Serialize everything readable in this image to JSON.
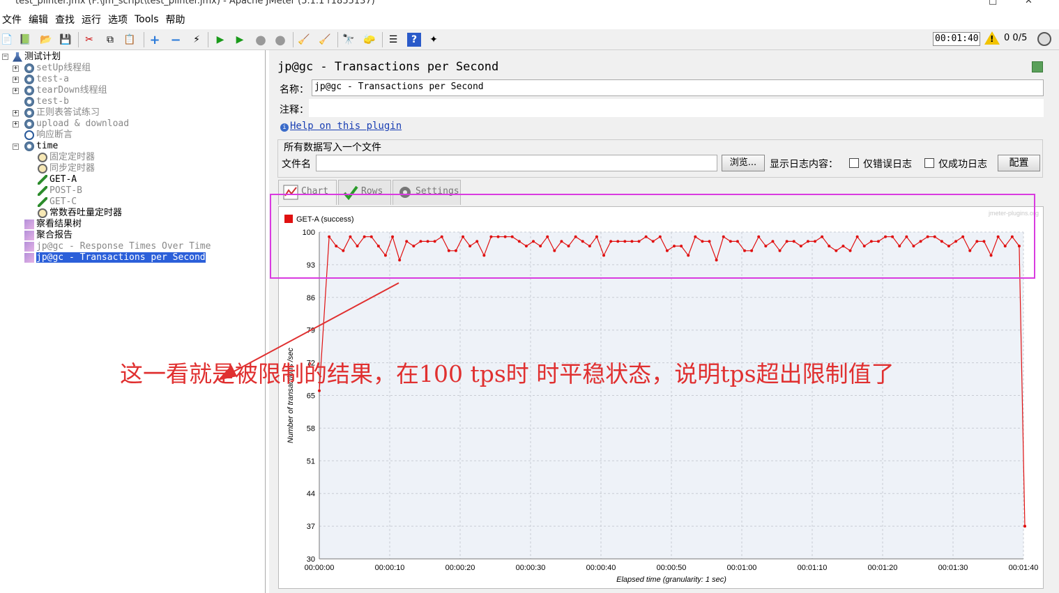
{
  "window": {
    "title": "test_plinter.jmx (F:\\jm_script\\test_plinter.jmx) - Apache JMeter (5.1.1 r1855137)"
  },
  "menu": [
    "文件",
    "编辑",
    "查找",
    "运行",
    "选项",
    "Tools",
    "帮助"
  ],
  "status": {
    "timer": "00:01:40",
    "warnings": "0",
    "threads": "0/5"
  },
  "tree": {
    "root": "测试计划",
    "items": [
      "setUp线程组",
      "test-a",
      "tearDown线程组",
      "test-b",
      "正则表答试练习",
      "upload & download",
      "响应断言",
      "time",
      "固定定时器",
      "同步定时器",
      "GET-A",
      "POST-B",
      "GET-C",
      "常数吞吐量定时器",
      "察看结果树",
      "聚合报告",
      "jp@gc - Response Times Over Time",
      "jp@gc - Transactions per Second"
    ]
  },
  "panel": {
    "title": "jp@gc - Transactions per Second",
    "name_label": "名称：",
    "name_value": "jp@gc - Transactions per Second",
    "comment_label": "注释：",
    "help_link": "Help on this plugin",
    "file_group": "所有数据写入一个文件",
    "file_label": "文件名",
    "browse": "浏览...",
    "log_label": "显示日志内容：",
    "err_only": "仅错误日志",
    "ok_only": "仅成功日志",
    "config": "配置"
  },
  "tabs": [
    "Chart",
    "Rows",
    "Settings"
  ],
  "annotation": "这一看就是被限制的结果，在100 tps时 时平稳状态，说明tps超出限制值了",
  "chart_data": {
    "type": "line",
    "watermark": "jmeter-plugins.org",
    "xlabel": "Elapsed time (granularity: 1 sec)",
    "ylabel": "Number of transactions /sec",
    "ylim": [
      30,
      100
    ],
    "yticks": [
      "100",
      "93",
      "86",
      "79",
      "72",
      "65",
      "58",
      "51",
      "44",
      "37",
      "30"
    ],
    "xticks": [
      "00:00:00",
      "00:00:10",
      "00:00:20",
      "00:00:30",
      "00:00:40",
      "00:00:50",
      "00:01:00",
      "00:01:10",
      "00:01:20",
      "00:01:30",
      "00:01:40"
    ],
    "series": [
      {
        "name": "GET-A (success)",
        "color": "#e01010",
        "x": [
          0,
          1,
          2,
          3,
          4,
          5,
          6,
          7,
          8,
          9,
          10,
          11,
          12,
          13,
          14,
          15,
          16,
          17,
          18,
          19,
          20,
          21,
          22,
          23,
          24,
          25,
          26,
          27,
          28,
          29,
          30,
          31,
          32,
          33,
          34,
          35,
          36,
          37,
          38,
          39,
          40,
          41,
          42,
          43,
          44,
          45,
          46,
          47,
          48,
          49,
          50,
          51,
          52,
          53,
          54,
          55,
          56,
          57,
          58,
          59,
          60,
          61,
          62,
          63,
          64,
          65,
          66,
          67,
          68,
          69,
          70,
          71,
          72,
          73,
          74,
          75,
          76,
          77,
          78,
          79,
          80,
          81,
          82,
          83,
          84,
          85,
          86,
          87,
          88,
          89,
          90,
          91,
          92,
          93,
          94,
          95,
          96,
          97,
          98,
          99,
          100,
          101
        ],
        "values": [
          66,
          99,
          97,
          96,
          99,
          97,
          99,
          99,
          97,
          95,
          99,
          94,
          98,
          97,
          98,
          98,
          98,
          99,
          96,
          96,
          99,
          97,
          98,
          95,
          99,
          99,
          99,
          99,
          98,
          97,
          98,
          97,
          99,
          96,
          98,
          97,
          99,
          98,
          97,
          99,
          95,
          98,
          98,
          98,
          98,
          98,
          99,
          98,
          99,
          96,
          97,
          97,
          95,
          99,
          98,
          98,
          94,
          99,
          98,
          98,
          96,
          96,
          99,
          97,
          98,
          96,
          98,
          98,
          97,
          98,
          98,
          99,
          97,
          96,
          97,
          96,
          99,
          97,
          98,
          98,
          99,
          99,
          97,
          99,
          97,
          98,
          99,
          99,
          98,
          97,
          98,
          99,
          96,
          98,
          98,
          95,
          99,
          97,
          99,
          97,
          37,
          37
        ]
      }
    ]
  }
}
